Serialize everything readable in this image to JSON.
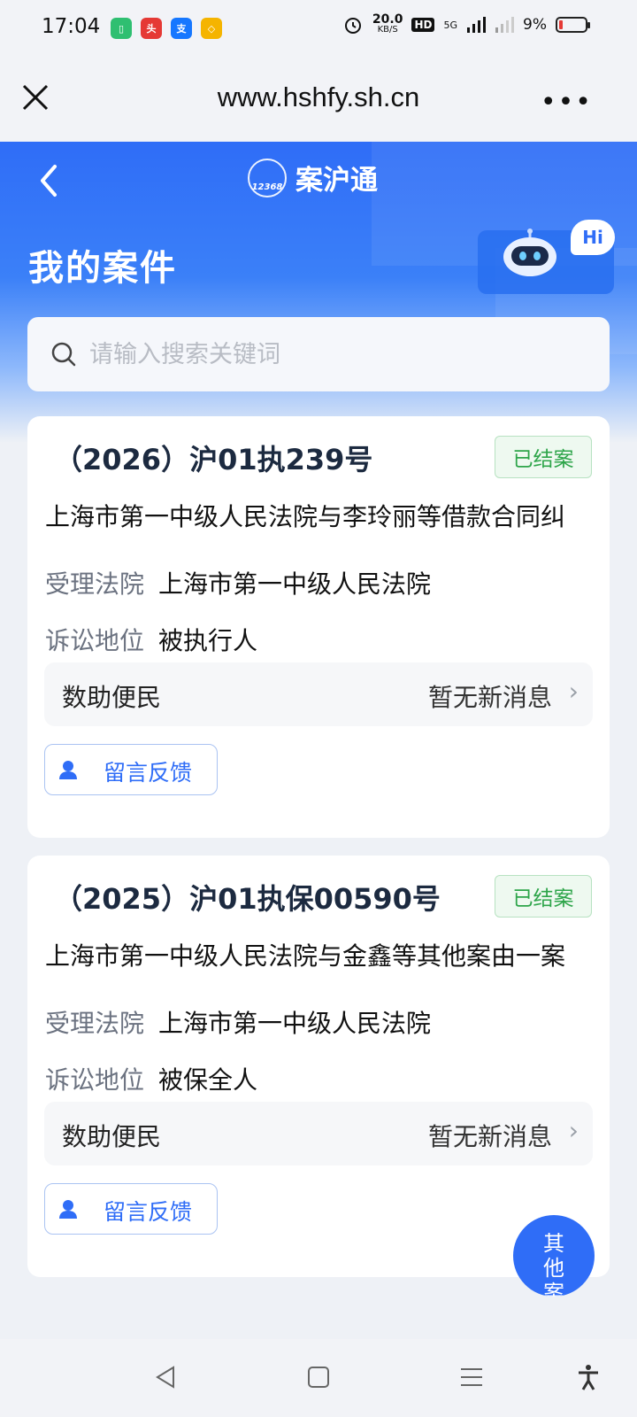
{
  "status_bar": {
    "time": "17:04",
    "net_speed_top": "20.0",
    "net_speed_unit": "KB/S",
    "hd_label": "HD",
    "signal_label": "5G",
    "battery": "9%"
  },
  "browser": {
    "url": "www.hshfy.sh.cn",
    "more_label": "•••"
  },
  "header": {
    "brand_name": "案沪通",
    "brand_logo_text": "12368",
    "page_title": "我的案件",
    "hi_label": "Hi"
  },
  "search": {
    "placeholder": "请输入搜索关键词"
  },
  "cases": [
    {
      "case_no": "（2026）沪01执239号",
      "status": "已结案",
      "title": "上海市第一中级人民法院与李玲丽等借款合同纠",
      "court_label": "受理法院",
      "court": "上海市第一中级人民法院",
      "role_label": "诉讼地位",
      "role": "被执行人",
      "notice_label": "数助便民",
      "notice_value": "暂无新消息",
      "feedback_label": "留言反馈"
    },
    {
      "case_no": "（2025）沪01执保00590号",
      "status": "已结案",
      "title": "上海市第一中级人民法院与金鑫等其他案由一案",
      "court_label": "受理法院",
      "court": "上海市第一中级人民法院",
      "role_label": "诉讼地位",
      "role": "被保全人",
      "notice_label": "数助便民",
      "notice_value": "暂无新消息",
      "feedback_label": "留言反馈"
    }
  ],
  "float_button": {
    "label": "其他案"
  },
  "colors": {
    "primary": "#2f6df7",
    "status_green": "#2ea54a"
  }
}
